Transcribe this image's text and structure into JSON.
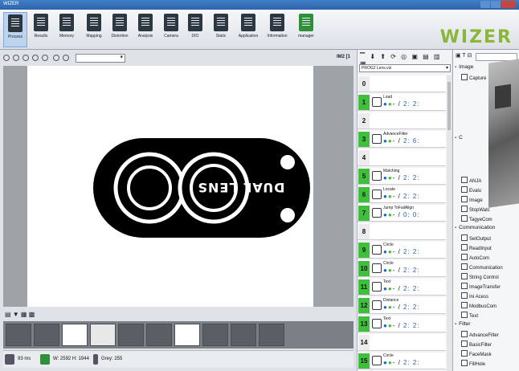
{
  "window": {
    "title": "WIZER"
  },
  "ribbon": {
    "tools": [
      {
        "label": "Process",
        "icon": "process-icon"
      },
      {
        "label": "Results",
        "icon": "results-icon"
      },
      {
        "label": "Memory",
        "icon": "memory-icon"
      },
      {
        "label": "Mapping",
        "icon": "mapping-icon"
      },
      {
        "label": "Distortion",
        "icon": "distortion-icon"
      },
      {
        "label": "Analysis",
        "icon": "analysis-icon"
      },
      {
        "label": "Camera",
        "icon": "camera-icon"
      },
      {
        "label": "DIO",
        "icon": "dio-icon"
      },
      {
        "label": "Static",
        "icon": "static-icon"
      },
      {
        "label": "Application",
        "icon": "application-icon"
      },
      {
        "label": "Information",
        "icon": "information-icon"
      },
      {
        "label": "manager",
        "icon": "manager-icon"
      }
    ],
    "logo": "WIZER"
  },
  "viewer": {
    "zoom": "IM2 [1",
    "image_text": "DUAL LENS"
  },
  "status": {
    "time": "93 ms",
    "size": "W: 2592 H: 1944",
    "gray": "Grey: 255"
  },
  "program": {
    "file": "PROG2 Lens.viz",
    "steps": [
      {
        "n": "0",
        "name": "",
        "filled": false
      },
      {
        "n": "1",
        "name": "Load",
        "filled": true,
        "ctrl": "2: 2:"
      },
      {
        "n": "2",
        "name": "",
        "filled": false
      },
      {
        "n": "3",
        "name": "AdvanceFilter",
        "filled": true,
        "ctrl": "2: 6:"
      },
      {
        "n": "4",
        "name": "",
        "filled": false
      },
      {
        "n": "5",
        "name": "Matching",
        "filled": true,
        "ctrl": "2: 2:"
      },
      {
        "n": "6",
        "name": "Locate",
        "filled": true,
        "ctrl": "2: 2:"
      },
      {
        "n": "7",
        "name": "Jump ToFailAlign",
        "filled": true,
        "ctrl": "0: 0:"
      },
      {
        "n": "8",
        "name": "",
        "filled": false
      },
      {
        "n": "9",
        "name": "Circle",
        "filled": true,
        "ctrl": "2: 2:"
      },
      {
        "n": "10",
        "name": "Circle",
        "filled": true,
        "ctrl": "2: 2:"
      },
      {
        "n": "11",
        "name": "Text",
        "filled": true,
        "ctrl": "2: 2:"
      },
      {
        "n": "12",
        "name": "Distance",
        "filled": true,
        "ctrl": "2: 2:"
      },
      {
        "n": "13",
        "name": "Text",
        "filled": true,
        "ctrl": "2: 2:"
      },
      {
        "n": "14",
        "name": "",
        "filled": false
      },
      {
        "n": "15",
        "name": "Circle",
        "filled": true,
        "ctrl": "2: 2:"
      }
    ]
  },
  "library": {
    "items": [
      {
        "label": "Image",
        "cat": true
      },
      {
        "label": "Capture",
        "cat": false
      },
      {
        "label": "C",
        "cat": true
      },
      {
        "label": "ANJA",
        "cat": false
      },
      {
        "label": "Evalu",
        "cat": false
      },
      {
        "label": "Image",
        "cat": false
      },
      {
        "label": "StopWatc",
        "cat": false
      },
      {
        "label": "TagyeCom",
        "cat": false
      },
      {
        "label": "Communication",
        "cat": true
      },
      {
        "label": "SetOutput",
        "cat": false
      },
      {
        "label": "ReadInput",
        "cat": false
      },
      {
        "label": "AutoCom",
        "cat": false
      },
      {
        "label": "Communication",
        "cat": false
      },
      {
        "label": "String Control",
        "cat": false
      },
      {
        "label": "ImageTransfer",
        "cat": false
      },
      {
        "label": "Ini Acess",
        "cat": false
      },
      {
        "label": "ModbusCom",
        "cat": false
      },
      {
        "label": "Text",
        "cat": false
      },
      {
        "label": "Filter",
        "cat": true
      },
      {
        "label": "AdvanceFilter",
        "cat": false
      },
      {
        "label": "BasicFilter",
        "cat": false
      },
      {
        "label": "FaceMask",
        "cat": false
      },
      {
        "label": "FillHole",
        "cat": false
      }
    ]
  },
  "colors": {
    "accent": "#3fbf3b",
    "logo": "#8bb63a",
    "titlebar": "#2d64a8"
  }
}
